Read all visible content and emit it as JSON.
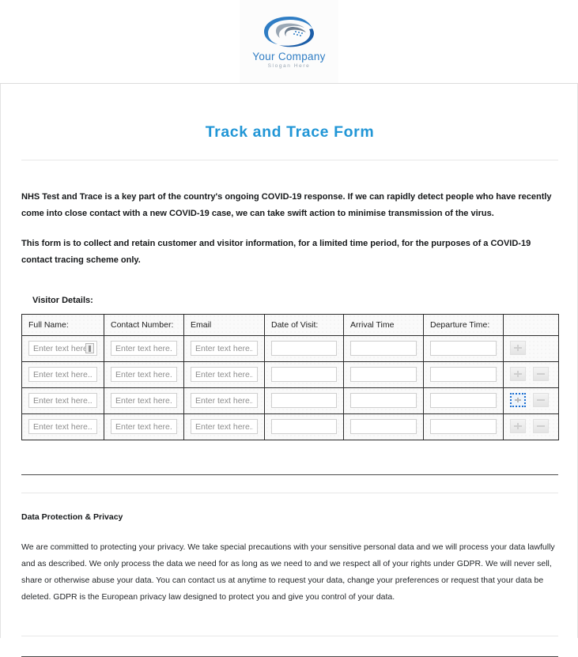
{
  "logo": {
    "company": "Your Company",
    "slogan": "Slogan Here",
    "mark_icon": "swoosh-logo-icon",
    "brand_blue": "#2f7dc4",
    "brand_dark_blue": "#1c5ea8",
    "brand_grey": "#9aa7b4"
  },
  "document": {
    "title": "Track and Trace Form",
    "title_color": "#2196d6",
    "intro_paragraph_1": "NHS Test and Trace is a key part of the country's ongoing COVID-19 response. If we can rapidly detect people who have recently come into close contact with a new COVID-19 case, we can take swift action to minimise transmission of the virus.",
    "intro_paragraph_2": "This form is to collect and retain customer and visitor information, for a limited time period, for the purposes of a COVID-19 contact tracing scheme only."
  },
  "visitor_section": {
    "label": "Visitor Details:",
    "columns": [
      "Full Name:",
      "Contact Number:",
      "Email",
      "Date of Visit:",
      "Arrival Time",
      "Departure Time:",
      ""
    ],
    "placeholder": "Enter text here...",
    "empty_placeholder": "",
    "rows": [
      {
        "full_name": "",
        "contact_number": "",
        "email": "",
        "date_of_visit": "",
        "arrival_time": "",
        "departure_time": "",
        "has_add": true,
        "has_remove": false,
        "add_focused": false,
        "has_grip": true
      },
      {
        "full_name": "",
        "contact_number": "",
        "email": "",
        "date_of_visit": "",
        "arrival_time": "",
        "departure_time": "",
        "has_add": true,
        "has_remove": true,
        "add_focused": false,
        "has_grip": false
      },
      {
        "full_name": "",
        "contact_number": "",
        "email": "",
        "date_of_visit": "",
        "arrival_time": "",
        "departure_time": "",
        "has_add": true,
        "has_remove": true,
        "add_focused": true,
        "has_grip": false
      },
      {
        "full_name": "",
        "contact_number": "",
        "email": "",
        "date_of_visit": "",
        "arrival_time": "",
        "departure_time": "",
        "has_add": true,
        "has_remove": true,
        "add_focused": false,
        "has_grip": false
      }
    ],
    "add_button_icon": "plus-icon",
    "remove_button_icon": "minus-icon",
    "grip_icon": "resize-grip-icon",
    "focus_outline_color": "#1d6fd0"
  },
  "privacy_section": {
    "heading": "Data Protection & Privacy",
    "body": "We are committed to protecting your privacy. We take special precautions with your sensitive personal data and we will process your data lawfully and as described. We only process the data we need for as long as we need to and we respect all of your rights under GDPR. We will never sell, share or otherwise abuse your data. You can contact us at anytime to request your data, change your preferences or request that your data be deleted. GDPR is the European privacy law designed to protect you and give you control of your data."
  }
}
